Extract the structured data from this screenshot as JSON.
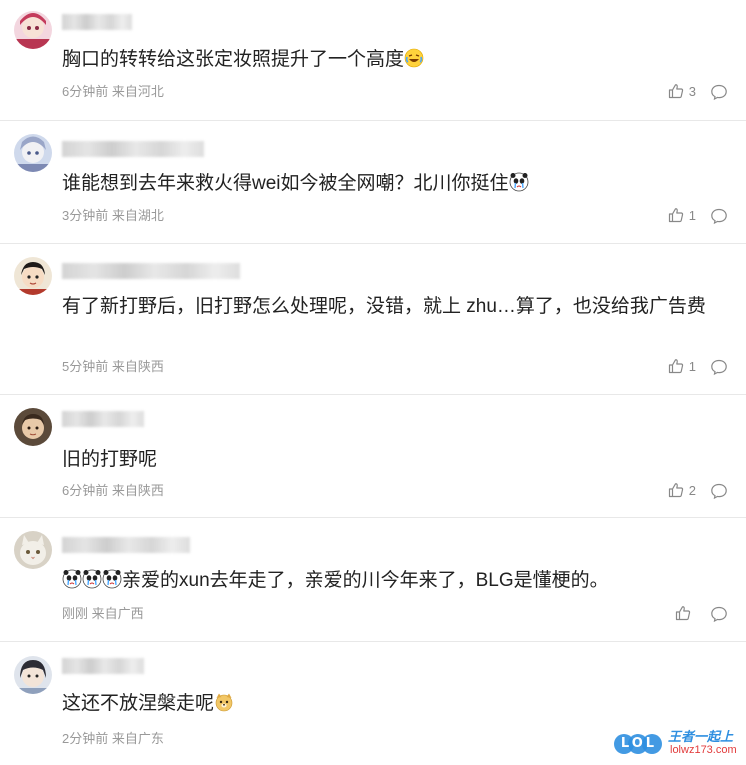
{
  "comments": [
    {
      "text": "胸口的转转给这张定妆照提升了一个高度",
      "emoji": "laughing-tears-emoji",
      "meta": "6分钟前 来自河北",
      "likes": "3"
    },
    {
      "text": "谁能想到去年来救火得wei如今被全网嘲？北川你挺住",
      "emoji": "crying-panda-emoji",
      "meta": "3分钟前 来自湖北",
      "likes": "1"
    },
    {
      "text": "有了新打野后，旧打野怎么处理呢，没错，就上 zhu…算了，也没给我广告费",
      "meta": "5分钟前 来自陕西",
      "likes": "1"
    },
    {
      "text": "旧的打野呢",
      "meta": "6分钟前 来自陕西",
      "likes": "2"
    },
    {
      "text": "亲爱的xun去年走了，亲爱的川今年来了，BLG是懂梗的。",
      "emoji": "crying-panda-emoji",
      "meta": "刚刚 来自广西",
      "likes": ""
    },
    {
      "text": "这还不放涅槃走呢",
      "emoji": "dog-face-emoji",
      "meta": "2分钟前 来自广东",
      "likes": ""
    }
  ],
  "watermark": {
    "logo": "LOL",
    "brand": "王者一起上",
    "site": "lolwz173.com"
  },
  "colors": {
    "text": "#222222",
    "meta": "#999999",
    "divider": "#e8e8e8",
    "watermark_blue": "#2f8fe0",
    "watermark_red": "#e23b3b"
  }
}
